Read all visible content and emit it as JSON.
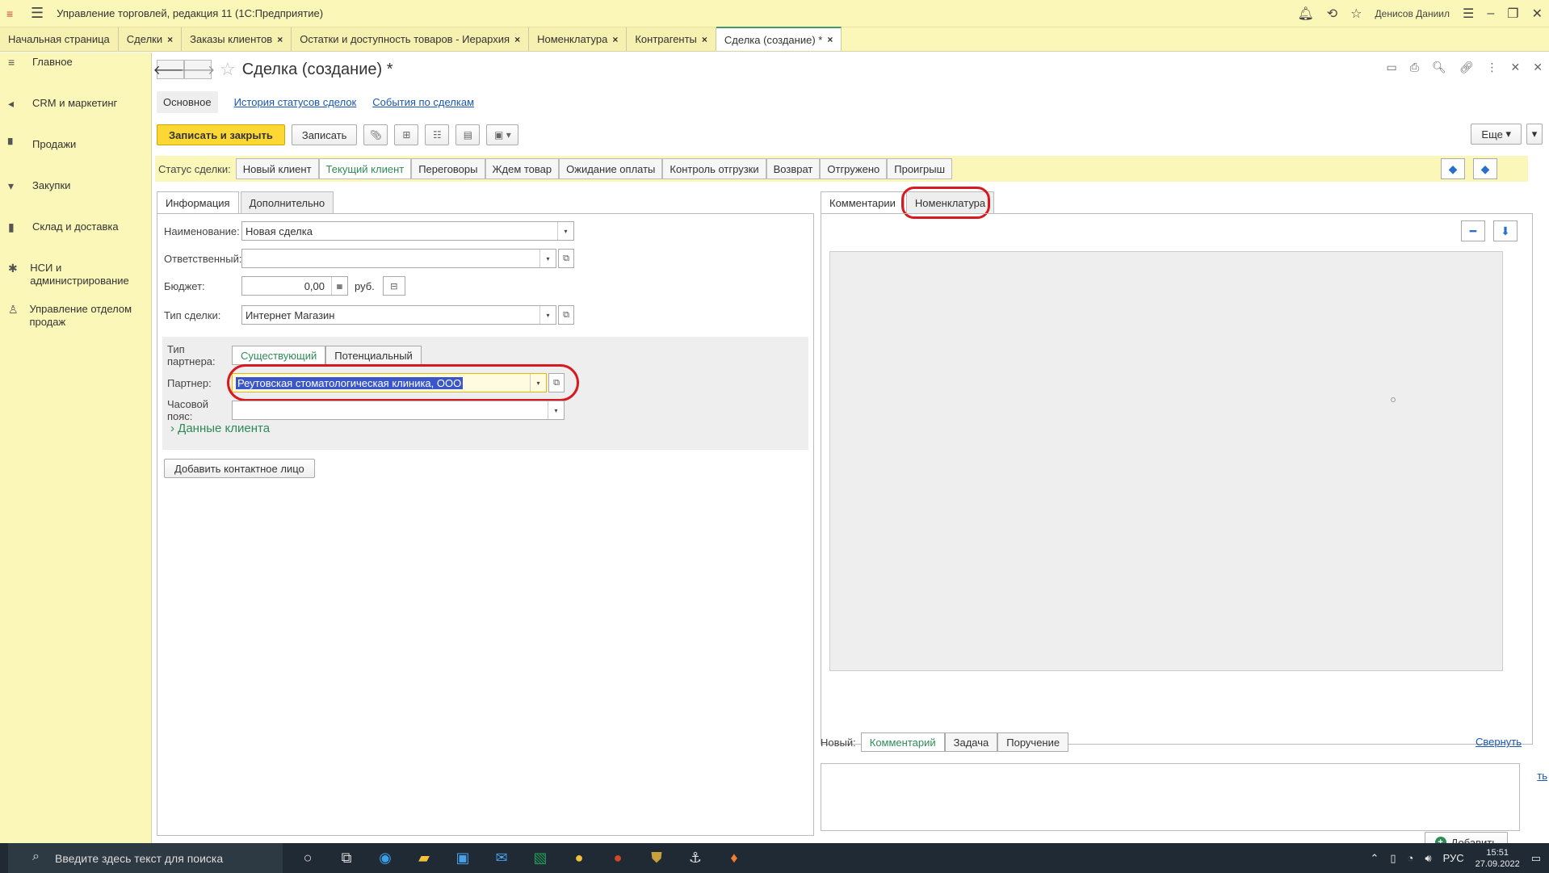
{
  "window": {
    "title": "Управление торговлей, редакция 11  (1С:Предприятие)",
    "user": "Денисов Даниил"
  },
  "open_tabs": [
    {
      "label": "Начальная страница",
      "closable": false
    },
    {
      "label": "Сделки",
      "closable": true
    },
    {
      "label": "Заказы клиентов",
      "closable": true
    },
    {
      "label": "Остатки и доступность товаров - Иерархия",
      "closable": true
    },
    {
      "label": "Номенклатура",
      "closable": true
    },
    {
      "label": "Контрагенты",
      "closable": true
    },
    {
      "label": "Сделка (создание) *",
      "closable": true,
      "active": true
    }
  ],
  "sidebar": {
    "items": [
      {
        "label": "Главное",
        "icon": "list-icon"
      },
      {
        "label": "CRM и маркетинг",
        "icon": "megaphone-icon"
      },
      {
        "label": "Продажи",
        "icon": "shop-icon"
      },
      {
        "label": "Закупки",
        "icon": "cart-icon"
      },
      {
        "label": "Склад и доставка",
        "icon": "warehouse-icon"
      },
      {
        "label": "НСИ и администрирование",
        "icon": "gear-icon"
      },
      {
        "label": "Управление отделом продаж",
        "icon": "people-icon"
      }
    ]
  },
  "form": {
    "title": "Сделка (создание) *",
    "sections": {
      "current": "Основное",
      "links": [
        "История статусов сделок",
        "События по сделкам"
      ]
    },
    "commands": {
      "save_close": "Записать и закрыть",
      "save": "Записать",
      "more": "Еще"
    },
    "status": {
      "label": "Статус сделки:",
      "options": [
        "Новый клиент",
        "Текущий клиент",
        "Переговоры",
        "Ждем товар",
        "Ожидание оплаты",
        "Контроль отгрузки",
        "Возврат",
        "Отгружено",
        "Проигрыш"
      ],
      "selected": "Текущий клиент"
    },
    "left_tabs": [
      "Информация",
      "Дополнительно"
    ],
    "fields": {
      "name_label": "Наименование:",
      "name_value": "Новая сделка",
      "responsible_label": "Ответственный:",
      "responsible_value": "",
      "budget_label": "Бюджет:",
      "budget_value": "0,00",
      "budget_currency": "руб.",
      "deal_type_label": "Тип сделки:",
      "deal_type_value": "Интернет Магазин",
      "partner_type_label": "Тип партнера:",
      "partner_type_options": [
        "Существующий",
        "Потенциальный"
      ],
      "partner_type_selected": "Существующий",
      "partner_label": "Партнер:",
      "partner_value": "Реутовская стоматологическая клиника, ООО",
      "timezone_label": "Часовой пояс:",
      "timezone_value": "",
      "client_data": "Данные клиента",
      "add_contact": "Добавить контактное лицо"
    },
    "right_tabs": [
      "Комментарии",
      "Номенклатура"
    ],
    "new_item": {
      "label": "Новый:",
      "options": [
        "Комментарий",
        "Задача",
        "Поручение"
      ],
      "selected": "Комментарий",
      "collapse": "Свернуть",
      "edge_fragment": "ть",
      "add": "Добавить"
    }
  },
  "taskbar": {
    "search_placeholder": "Введите здесь текст для поиска",
    "lang": "РУС",
    "time": "15:51",
    "date": "27.09.2022"
  },
  "colors": {
    "panel_yellow": "#fbf7b9",
    "accent_green": "#2e8b57",
    "primary_button": "#fdd835",
    "annotation_red": "#d8191f",
    "link_blue": "#1a57b0"
  }
}
